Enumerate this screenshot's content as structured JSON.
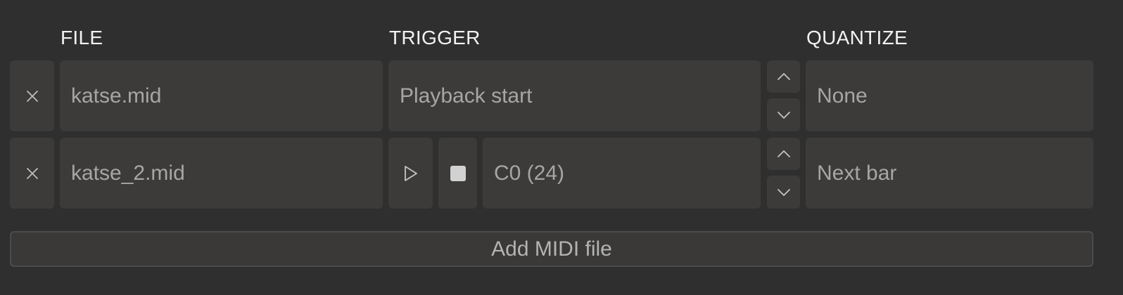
{
  "headers": {
    "file": "FILE",
    "trigger": "TRIGGER",
    "quantize": "QUANTIZE"
  },
  "rows": [
    {
      "file": "katse.mid",
      "trigger": "Playback start",
      "quantize": "None"
    },
    {
      "file": "katse_2.mid",
      "trigger": "C0 (24)",
      "quantize": "Next bar"
    }
  ],
  "icons": {
    "remove": "close-icon",
    "play": "play-icon",
    "stop": "stop-icon",
    "up": "chevron-up-icon",
    "down": "chevron-down-icon"
  },
  "add_button_label": "Add MIDI file",
  "colors": {
    "background": "#2f2f2f",
    "cell": "#3c3b3a",
    "header_text": "#f2f2f2",
    "cell_text": "#a6a6a6"
  }
}
